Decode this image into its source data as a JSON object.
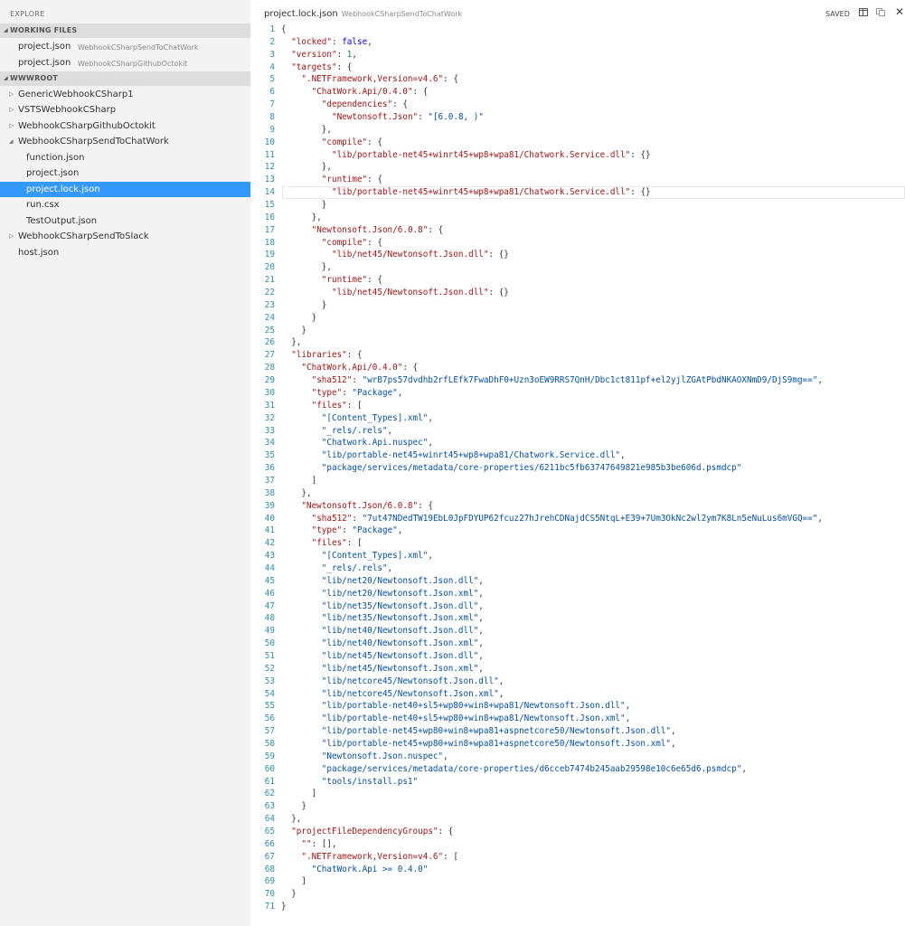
{
  "sidebar": {
    "title": "EXPLORE",
    "working_files_header": "WORKING FILES",
    "working_files": [
      {
        "name": "project.json",
        "dir": "WebhookCSharpSendToChatWork"
      },
      {
        "name": "project.json",
        "dir": "WebhookCSharpGithubOctokit"
      }
    ],
    "root_header": "WWWROOT",
    "tree": [
      {
        "name": "GenericWebhookCSharp1",
        "twist": "▷"
      },
      {
        "name": "VSTSWebhookCSharp",
        "twist": "▷"
      },
      {
        "name": "WebhookCSharpGithubOctokit",
        "twist": "▷"
      },
      {
        "name": "WebhookCSharpSendToChatWork",
        "twist": "◢"
      },
      {
        "name": "function.json",
        "twist": ""
      },
      {
        "name": "project.json",
        "twist": ""
      },
      {
        "name": "project.lock.json",
        "twist": ""
      },
      {
        "name": "run.csx",
        "twist": ""
      },
      {
        "name": "TestOutput.json",
        "twist": ""
      },
      {
        "name": "WebhookCSharpSendToSlack",
        "twist": "▷"
      },
      {
        "name": "host.json",
        "twist": ""
      }
    ]
  },
  "editor": {
    "file_name": "project.lock.json",
    "file_dir": "WebhookCSharpSendToChatWork",
    "status": "SAVED",
    "current_line": 14,
    "lines": [
      "{",
      "  \"locked\": false,",
      "  \"version\": 1,",
      "  \"targets\": {",
      "    \".NETFramework,Version=v4.6\": {",
      "      \"ChatWork.Api/0.4.0\": {",
      "        \"dependencies\": {",
      "          \"Newtonsoft.Json\": \"[6.0.8, )\"",
      "        },",
      "        \"compile\": {",
      "          \"lib/portable-net45+winrt45+wp8+wpa81/Chatwork.Service.dll\": {}",
      "        },",
      "        \"runtime\": {",
      "          \"lib/portable-net45+winrt45+wp8+wpa81/Chatwork.Service.dll\": {}",
      "        }",
      "      },",
      "      \"Newtonsoft.Json/6.0.8\": {",
      "        \"compile\": {",
      "          \"lib/net45/Newtonsoft.Json.dll\": {}",
      "        },",
      "        \"runtime\": {",
      "          \"lib/net45/Newtonsoft.Json.dll\": {}",
      "        }",
      "      }",
      "    }",
      "  },",
      "  \"libraries\": {",
      "    \"ChatWork.Api/0.4.0\": {",
      "      \"sha512\": \"wrB7ps57dvdhb2rfLEfk7FwaDhF0+Uzn3oEW9RRS7QnH/Dbc1ct811pf+el2yjlZGAtPbdNKAOXNmD9/DjS9mg==\",",
      "      \"type\": \"Package\",",
      "      \"files\": [",
      "        \"[Content_Types].xml\",",
      "        \"_rels/.rels\",",
      "        \"Chatwork.Api.nuspec\",",
      "        \"lib/portable-net45+winrt45+wp8+wpa81/Chatwork.Service.dll\",",
      "        \"package/services/metadata/core-properties/6211bc5fb63747649821e985b3be606d.psmdcp\"",
      "      ]",
      "    },",
      "    \"Newtonsoft.Json/6.0.8\": {",
      "      \"sha512\": \"7ut47NDedTW19EbL0JpFDYUP62fcuz27hJrehCDNajdCS5NtqL+E39+7Um3OkNc2wl2ym7K8Ln5eNuLus6mVGQ==\",",
      "      \"type\": \"Package\",",
      "      \"files\": [",
      "        \"[Content_Types].xml\",",
      "        \"_rels/.rels\",",
      "        \"lib/net20/Newtonsoft.Json.dll\",",
      "        \"lib/net20/Newtonsoft.Json.xml\",",
      "        \"lib/net35/Newtonsoft.Json.dll\",",
      "        \"lib/net35/Newtonsoft.Json.xml\",",
      "        \"lib/net40/Newtonsoft.Json.dll\",",
      "        \"lib/net40/Newtonsoft.Json.xml\",",
      "        \"lib/net45/Newtonsoft.Json.dll\",",
      "        \"lib/net45/Newtonsoft.Json.xml\",",
      "        \"lib/netcore45/Newtonsoft.Json.dll\",",
      "        \"lib/netcore45/Newtonsoft.Json.xml\",",
      "        \"lib/portable-net40+sl5+wp80+win8+wpa81/Newtonsoft.Json.dll\",",
      "        \"lib/portable-net40+sl5+wp80+win8+wpa81/Newtonsoft.Json.xml\",",
      "        \"lib/portable-net45+wp80+win8+wpa81+aspnetcore50/Newtonsoft.Json.dll\",",
      "        \"lib/portable-net45+wp80+win8+wpa81+aspnetcore50/Newtonsoft.Json.xml\",",
      "        \"Newtonsoft.Json.nuspec\",",
      "        \"package/services/metadata/core-properties/d6cceb7474b245aab29598e10c6e65d6.psmdcp\",",
      "        \"tools/install.ps1\"",
      "      ]",
      "    }",
      "  },",
      "  \"projectFileDependencyGroups\": {",
      "    \"\": [],",
      "    \".NETFramework,Version=v4.6\": [",
      "      \"ChatWork.Api >= 0.4.0\"",
      "    ]",
      "  }",
      "}"
    ]
  },
  "colors": {
    "selection": "#3399ff",
    "line_number": "#2b91af",
    "json_key": "#a31515",
    "json_string": "#0451a5",
    "json_keyword": "#0000ff",
    "json_number": "#09885a"
  }
}
